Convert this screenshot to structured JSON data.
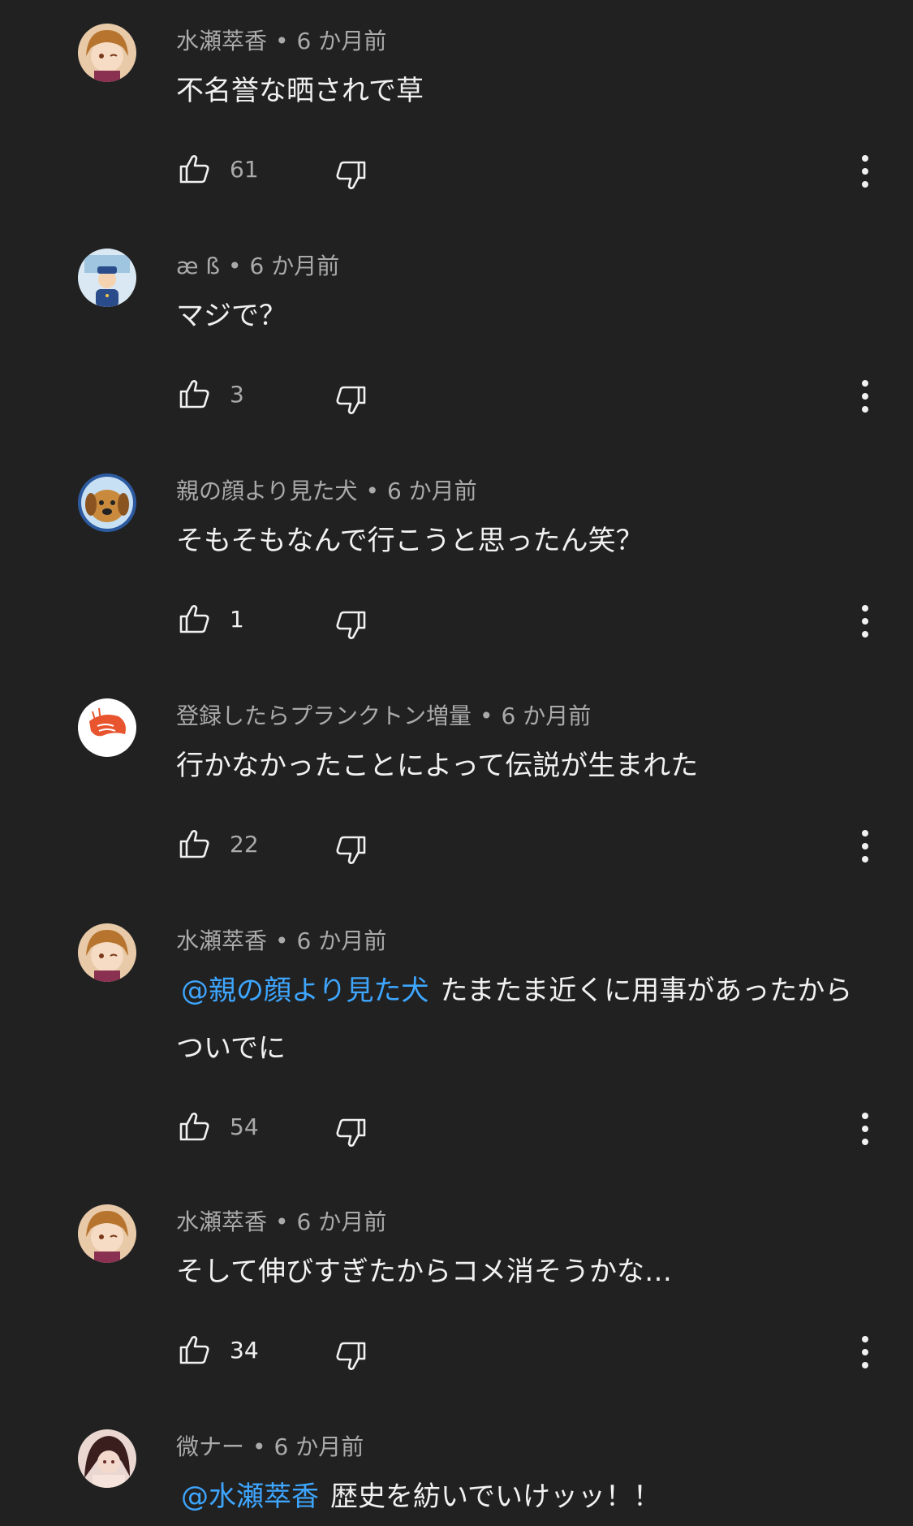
{
  "comments": [
    {
      "author": "水瀬萃香",
      "separator": "•",
      "time": "6 か月前",
      "text": "不名誉な晒されで草",
      "mention": "",
      "likes": "61",
      "avatar": "anime-girl-avatar"
    },
    {
      "author": "æ ß",
      "separator": "•",
      "time": "6 か月前",
      "text": "マジで？",
      "mention": "",
      "likes": "3",
      "avatar": "police-officer-avatar"
    },
    {
      "author": "親の顔より見た犬",
      "separator": "•",
      "time": "6 か月前",
      "text": "そもそもなんで行こうと思ったん笑？",
      "mention": "",
      "likes": "1",
      "avatar": "dog-avatar"
    },
    {
      "author": "登録したらプランクトン増量",
      "separator": "•",
      "time": "6 か月前",
      "text": "行かなかったことによって伝説が生まれた",
      "mention": "",
      "likes": "22",
      "avatar": "shrimp-avatar"
    },
    {
      "author": "水瀬萃香",
      "separator": "•",
      "time": "6 か月前",
      "mention": "@親の顔より見た犬",
      "text": "たまたま近くに用事があったからついでに",
      "likes": "54",
      "avatar": "anime-girl-avatar"
    },
    {
      "author": "水瀬萃香",
      "separator": "•",
      "time": "6 か月前",
      "text": "そして伸びすぎたからコメ消そうかな…",
      "mention": "",
      "likes": "34",
      "avatar": "anime-girl-avatar"
    },
    {
      "author": "微ナー",
      "separator": "•",
      "time": "6 か月前",
      "mention": "@水瀬萃香",
      "text": "歴史を紡いでいけッッ！！",
      "likes": "",
      "avatar": "anime-woman-avatar"
    }
  ],
  "colors": {
    "background": "#212121",
    "text_primary": "#f1f1f1",
    "text_secondary": "#aaaaaa",
    "mention": "#3ea6ff"
  },
  "icons": {
    "like": "thumbs-up-icon",
    "dislike": "thumbs-down-icon",
    "more": "more-vert-icon"
  }
}
